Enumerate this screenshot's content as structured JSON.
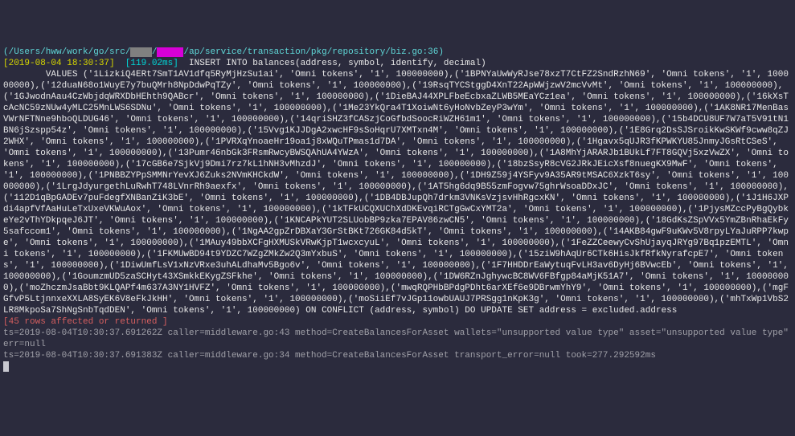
{
  "header": {
    "path_prefix": "(/Users/hww/work/go/src/",
    "redact1": "    ",
    "slash": "/",
    "redact2": "     ",
    "path_suffix": "/ap/service/transaction/pkg/repository/biz.go:36)"
  },
  "query_line": {
    "timestamp": "[2019-08-04 18:30:37]",
    "duration": "[119.02ms]",
    "sql_head": "  INSERT INTO balances(address, symbol, identify, decimal)"
  },
  "sql_body": "        VALUES ('1LizkiQ4ERt7SmT1AV1dfq5RyMjHzSu1ai', 'Omni tokens', '1', 100000000),('1BPNYaUwWyRJse78xzT7CtFZ2SndRzhN69', 'Omni tokens', '1', 100000000),('12duaN68o1WuyE7y7buQMrh8NpDdwPqTZy', 'Omni tokens', '1', 100000000),('19RsqTYCStggD4XnT22ApWWjzwV2mcVvMt', 'Omni tokens', '1', 100000000),('1GJwodnAau4CzWbjdqWRXDbHEhth9QABcr', 'Omni tokens', '1', 100000000),('1DieBAJ44XPLFbeEcbxaZLWB5MEaYCz1ea', 'Omni tokens', '1', 100000000),('16kXsTcAcNC59zNUw4yMLC25MnLWS6SDNu', 'Omni tokens', '1', 100000000),('1Me23YkQra4T1XoiwNt6yHoNvbZeyP3wYm', 'Omni tokens', '1', 100000000),('1AK8NR17MenBasVWrNFTNne9hboQLDUG46', 'Omni tokens', '1', 100000000),('14qriSHZ3fCASzjCoGfbdSoocRiWZH61m1', 'Omni tokens', '1', 100000000),('15b4DCU8UF7W7aT5V91tN1BN6jSzspp54z', 'Omni tokens', '1', 100000000),('15Vvg1KJJDgA2xwcHF9sSoHqrU7XMTxn4M', 'Omni tokens', '1', 100000000),('1E8Grq2DsSJSroikKwSKWf9cww8qZJ2WHX', 'Omni tokens', '1', 100000000),('1PVRXqYnoaeHr19oa1j8xWQuTPmas1d7DA', 'Omni tokens', '1', 100000000),('1Hgavx5qUJR3fKPWKYU85JnmyJGsRtCSeS', 'Omni tokens', '1', 100000000),('13Pumr46nbGk3FRsmRwcyBWSQAhUA4YWzA', 'Omni tokens', '1', 100000000),('1A8MhYjARARJb1BUkLf7FT8GQVj5xzVwZX', 'Omni tokens', '1', 100000000),('17cGB6e7SjkVj9Dmi7rz7kL1hNH3vMhzdJ', 'Omni tokens', '1', 100000000),('18bzSsyR8cVG2JRkJEicXsf8nuegKX9MwF', 'Omni tokens', '1', 100000000),('1PNBBZYPpSMMNrYevXJ6Zuks2NVmKHCkdW', 'Omni tokens', '1', 100000000),('1DH9Z59j4YSFyv9A35AR9tMSAC6XzkT6sy', 'Omni tokens', '1', 100000000),('1LrgJdyurgethLuRwhT748LVnrRh9aexfx', 'Omni tokens', '1', 100000000),('1AT5hg6dq9B55zmFogvw75ghrWsoaDDxJC', 'Omni tokens', '1', 100000000),('112D1qBpGADEv7puFdegfXNBanZiK3bE', 'Omni tokens', '1', 100000000),('1DB4DBJupQh7drkm3VNKsVzjsvHhRgcxKN', 'Omni tokens', '1', 100000000),('1J1H6JXPdi4apfVfAaHuLeTxUxeVKWuAox', 'Omni tokens', '1', 100000000),('1kTFkUCQXUChXdDKEvqiRCTgGwCxYMT2a', 'Omni tokens', '1', 100000000),('1PjysMZccPyBgQybkeYe2vThYDkpqeJ6JT', 'Omni tokens', '1', 100000000),('1KNCAPkYUT2SLUobBP9zka7EPAV86zwCN5', 'Omni tokens', '1', 100000000),('18GdKsZSpVVx5YmZBnRhaEkFy5safccom1', 'Omni tokens', '1', 100000000),('1NgAA2gpZrDBXaY3GrStBKt726GK84d5kT', 'Omni tokens', '1', 100000000),('14AKB84gwF9uKWv5V8rpyLYaJuRPP7kwpe', 'Omni tokens', '1', 100000000),('1MAuy49bbXCFgHXMUSkVRwKjpT1wcxcyuL', 'Omni tokens', '1', 100000000),('1FeZZCeewyCvShUjayqJRYg97Bq1pzEMTL', 'Omni tokens', '1', 100000000),('1FKMUwBD94t9YDZC7WZgZMkZw2Q3mYxbuS', 'Omni tokens', '1', 100000000),('15ziW9hAqUr6CTk6HisJkfRfkNyrafcpE7', 'Omni tokens', '1', 100000000),('1DiwUmfLsV1xNzVRxe3uhALdhaMv5Bgo6v', 'Omni tokens', '1', 100000000),('1F7HHDDrEaWytuqFvLH3av6DyHj6BVwcEb', 'Omni tokens', '1', 100000000),('1GoumzmUD5zaSCHyt43XSmkkEKygZSFkhe', 'Omni tokens', '1', 100000000),('1DW6RZnJghywcBC8WV6FBfgp84aMjK51A7', 'Omni tokens', '1', 100000000),('moZhczmJsaBbt9KLQAPf4m637A3NY1HVFZ', 'Omni tokens', '1', 100000000),('mwqRQPHbBPdgPDht6arXEf6e9DBrwmYhY9', 'Omni tokens', '1', 100000000),('mgFGfvP5LtjnnxeXXLA8SyEK6V8eFkJkHH', 'Omni tokens', '1', 100000000),('moSiiEf7vJGp11owbUAUJ7PRSgg1nKpK3g', 'Omni tokens', '1', 100000000),('mhTxWp1VbS2LR8MkpoSa7ShNgSnbTqdDEN', 'Omni tokens', '1', 100000000) ON CONFLICT (address, symbol) DO UPDATE SET address = excluded.address",
  "affected": "[45 rows affected or returned ]",
  "log1": "ts=2019-08-04T10:30:37.691262Z caller=middleware.go:43 method=CreateBalancesForAsset wallets=\"unsupported value type\" asset=\"unsupported value type\" err=null",
  "log2": "ts=2019-08-04T10:30:37.691383Z caller=middleware.go:34 method=CreateBalancesForAsset transport_error=null took=277.292592ms"
}
